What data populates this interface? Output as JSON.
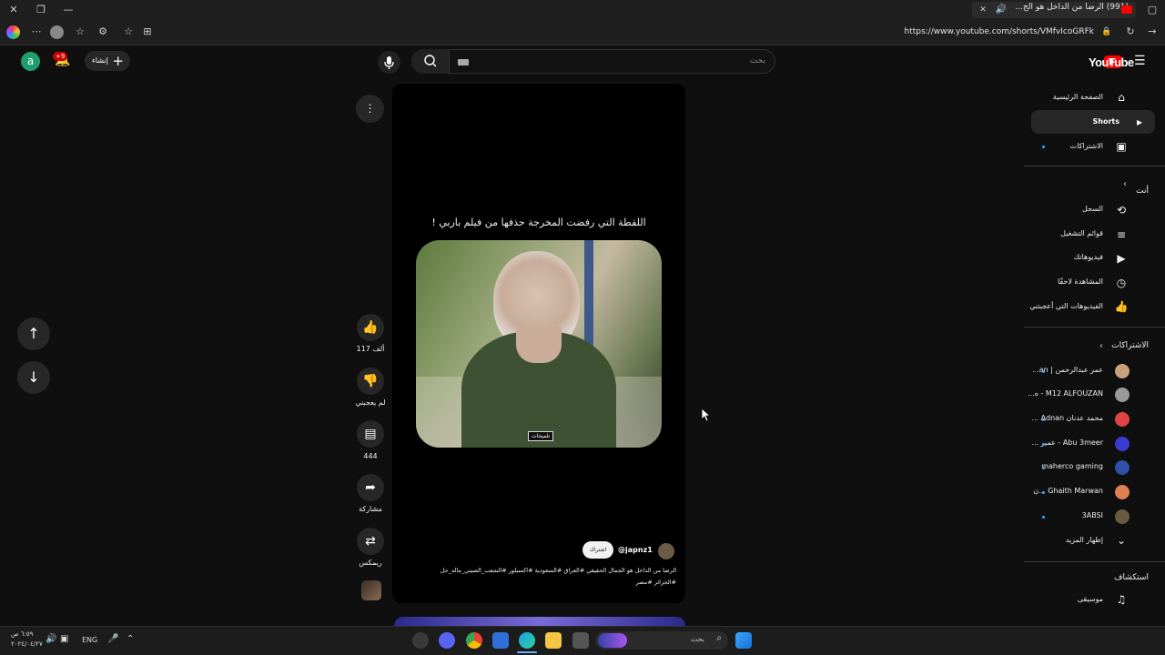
{
  "browser": {
    "tab_title": "(991) الرضا من الداخل هو الج...",
    "url": "https://www.youtube.com/shorts/VMfvIcoGRFk"
  },
  "header": {
    "logo": "YouTube",
    "search_placeholder": "بحث",
    "create_label": "إنشاء",
    "notifications_badge": "+9",
    "avatar_letter": "a"
  },
  "sidebar": {
    "main": [
      {
        "label": "الصفحة الرئيسية",
        "icon": "home-icon"
      },
      {
        "label": "Shorts",
        "icon": "shorts-icon"
      },
      {
        "label": "الاشتراكات",
        "icon": "subscriptions-icon"
      }
    ],
    "you_title": "أنت",
    "you": [
      {
        "label": "السجل",
        "icon": "history-icon"
      },
      {
        "label": "قوائم التشغيل",
        "icon": "playlist-icon"
      },
      {
        "label": "فيديوهاتك",
        "icon": "your-videos-icon"
      },
      {
        "label": "المشاهدة لاحقًا",
        "icon": "watch-later-icon"
      },
      {
        "label": "الفيديوهات التي أعجبتني",
        "icon": "liked-icon"
      }
    ],
    "subs_title": "الاشتراكات",
    "subs": [
      {
        "label": "عمر عبدالرحمن | an...",
        "color": "#c9a27a"
      },
      {
        "label": "M12 ALFOUZAN - ه...",
        "color": "#9a9a9a"
      },
      {
        "label": "محمد عدنان Adnan ...",
        "color": "#e04444"
      },
      {
        "label": "Abu 3meer - عمير ...",
        "color": "#3b3bd0"
      },
      {
        "label": "maherco gaming",
        "color": "#2f4fa8"
      },
      {
        "label": "Ghaith Marwan ...ن",
        "color": "#e08050"
      },
      {
        "label": "3ABSI",
        "color": "#6a5a40"
      }
    ],
    "show_more": "إظهار المزيد",
    "explore_title": "استكشاف",
    "explore": [
      {
        "label": "موسيقى",
        "icon": "music-icon"
      }
    ]
  },
  "short": {
    "overlay_title": "اللقطة التي رفضت المخرجة حذفها من فيلم باربي !",
    "caption_badge": "تلميحات",
    "channel": "@japnz1",
    "subscribe": "اشتراك",
    "description_line1": "الرضا من الداخل هو الجمال الحقيقي #العراق #السعودية #اكسبلور #الشعب_الصيني_ماله_حل",
    "description_line2": "#الجزائر #مصر",
    "likes": "117 ألف",
    "dislike_label": "لم يعجبني",
    "comments": "444",
    "share_label": "مشاركة",
    "remix_label": "ريمكس"
  },
  "taskbar": {
    "search_placeholder": "بحث",
    "lang": "ENG",
    "time": "٦:٥٩ ص",
    "date": "٢٠٢٤/٠٤/٢٧"
  }
}
